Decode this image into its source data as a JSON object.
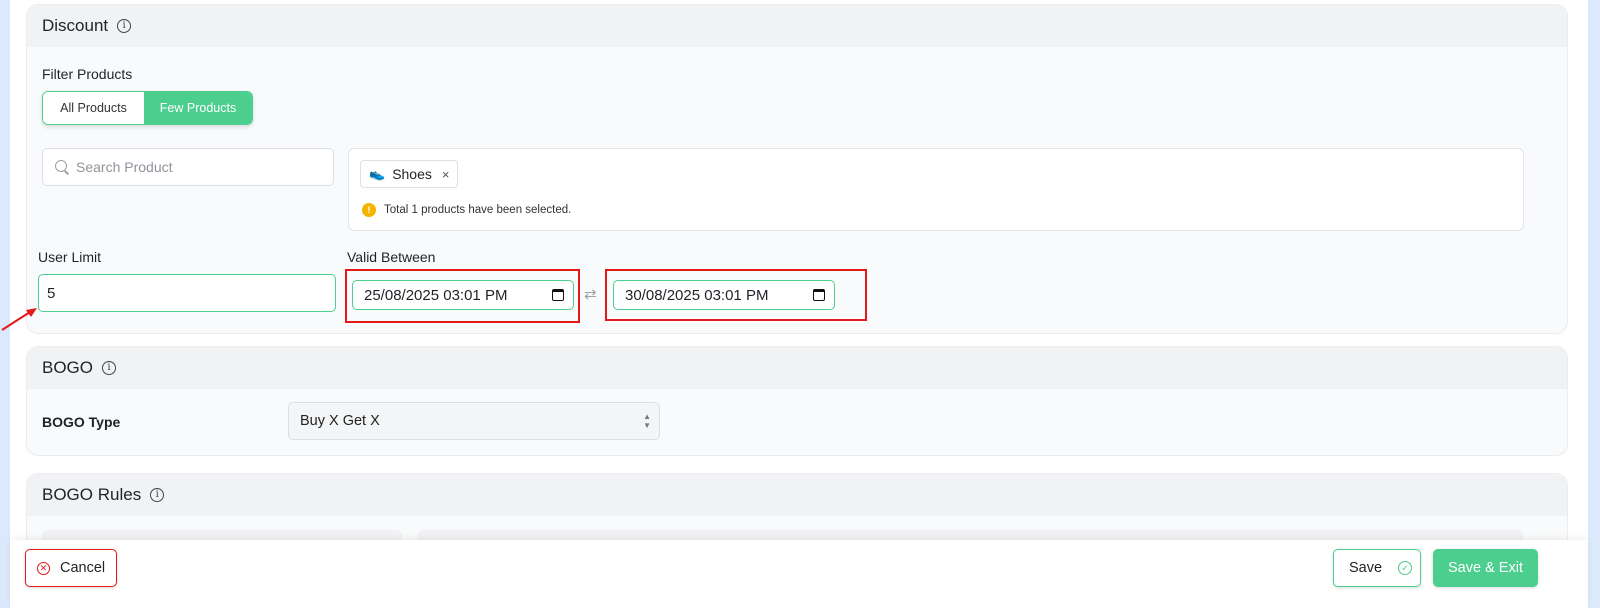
{
  "discount": {
    "title": "Discount",
    "filter_label": "Filter Products",
    "filter_options": {
      "all": "All Products",
      "few": "Few Products",
      "selected": "Few Products"
    },
    "search_placeholder": "Search Product",
    "selected_chip": {
      "label": "Shoes",
      "close": "×",
      "icon": "shoe-icon"
    },
    "selection_note": "Total 1 products have been selected.",
    "user_limit_label": "User Limit",
    "user_limit_value": "5",
    "valid_between_label": "Valid Between",
    "valid_from": "25/08/2025 03:01 PM",
    "valid_to": "30/08/2025 03:01 PM"
  },
  "bogo": {
    "title": "BOGO",
    "type_label": "BOGO Type",
    "type_value": "Buy X Get X"
  },
  "bogo_rules": {
    "title": "BOGO Rules"
  },
  "footer": {
    "cancel_label": "Cancel",
    "save_label": "Save",
    "save_exit_label": "Save & Exit"
  },
  "colors": {
    "accent": "#4cce8e",
    "highlight": "#e41919",
    "warning": "#f4b400"
  }
}
